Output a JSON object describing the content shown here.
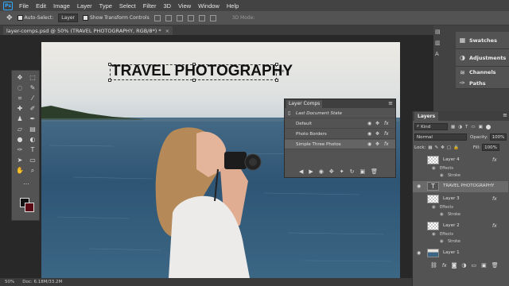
{
  "menubar": {
    "items": [
      "File",
      "Edit",
      "Image",
      "Layer",
      "Type",
      "Select",
      "Filter",
      "3D",
      "View",
      "Window",
      "Help"
    ]
  },
  "options": {
    "auto_select_label": "Auto-Select:",
    "auto_select_value": "Layer",
    "transform_label": "Show Transform Controls",
    "mode_3d": "3D Mode:"
  },
  "document": {
    "tab_title": "layer-comps.psd @ 50% (TRAVEL PHOTOGRAPHY, RGB/8*) *"
  },
  "canvas": {
    "headline": "TRAVEL PHOTOGRAPHY"
  },
  "side_panels": [
    {
      "label": "Swatches",
      "icon": "swatches-icon"
    },
    {
      "label": "Adjustments",
      "icon": "adjustments-icon"
    },
    {
      "label": "Channels",
      "icon": "channels-icon"
    },
    {
      "label": "Paths",
      "icon": "paths-icon"
    }
  ],
  "layer_comps": {
    "title": "Layer Comps",
    "rows": [
      {
        "name": "Last Document State"
      },
      {
        "name": "Default"
      },
      {
        "name": "Photo Borders"
      },
      {
        "name": "Simple Three Photos"
      }
    ]
  },
  "layers": {
    "title": "Layers",
    "filter_label": "Kind",
    "blend_mode": "Normal",
    "opacity_label": "Opacity:",
    "opacity_value": "100%",
    "lock_label": "Lock:",
    "fill_label": "Fill:",
    "fill_value": "100%",
    "items": [
      {
        "name": "Layer 4",
        "type": "raster",
        "effects_label": "Effects",
        "effect": "Stroke"
      },
      {
        "name": "TRAVEL PHOTOGRAPHY",
        "type": "text"
      },
      {
        "name": "Layer 3",
        "type": "raster",
        "effects_label": "Effects",
        "effect": "Stroke"
      },
      {
        "name": "Layer 2",
        "type": "raster",
        "effects_label": "Effects",
        "effect": "Stroke"
      },
      {
        "name": "Layer 1",
        "type": "photo"
      }
    ]
  },
  "status": {
    "zoom": "50%",
    "doc_info": "Doc: 6.18M/33.2M"
  },
  "colors": {
    "foreground": "#111111",
    "background": "#5a0a14",
    "accent": "#31a8ff"
  }
}
